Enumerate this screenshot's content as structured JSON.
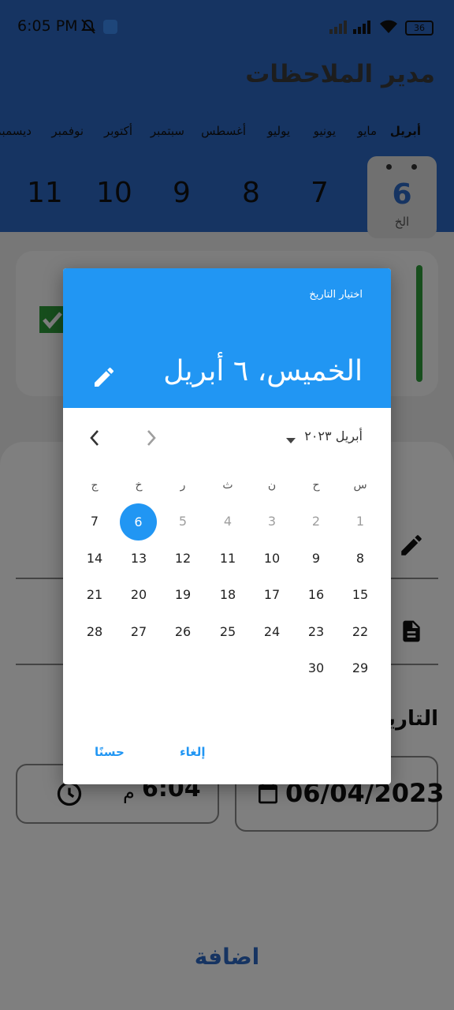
{
  "status": {
    "time": "6:05 PM",
    "battery": "36"
  },
  "app": {
    "title": "مدير الملاحظات"
  },
  "months": [
    "أبريل",
    "مايو",
    "يونيو",
    "يوليو",
    "أغسطس",
    "سبتمبر",
    "أكتوبر",
    "نوفمبر",
    "ديسمبر"
  ],
  "days": {
    "selected_day": "6",
    "selected_weekday": "الخ",
    "others": [
      "7",
      "8",
      "9",
      "10",
      "11"
    ]
  },
  "form": {
    "date_label": "التاريخ",
    "date_value": "06/04/2023",
    "time_value": "6:04",
    "time_suffix": "م",
    "add_button": "اضافة"
  },
  "dialog": {
    "help_text": "اختيار التاريخ",
    "selected_date": "الخميس، ٦ أبريل",
    "month_year": "أبريل ٢٠٢٣",
    "weekdays": [
      "س",
      "ح",
      "ن",
      "ث",
      "ر",
      "خ",
      "ج"
    ],
    "week1": [
      "1",
      "2",
      "3",
      "4",
      "5",
      "6",
      "7"
    ],
    "week2": [
      "8",
      "9",
      "10",
      "11",
      "12",
      "13",
      "14"
    ],
    "week3": [
      "15",
      "16",
      "17",
      "18",
      "19",
      "20",
      "21"
    ],
    "week4": [
      "22",
      "23",
      "24",
      "25",
      "26",
      "27",
      "28"
    ],
    "week5": [
      "29",
      "30"
    ],
    "cancel_label": "إلغاء",
    "ok_label": "حسنًا"
  },
  "colors": {
    "primary": "#2196f3",
    "appbar": "#2c68c4",
    "scrim": "rgba(0,0,0,0.5)"
  }
}
